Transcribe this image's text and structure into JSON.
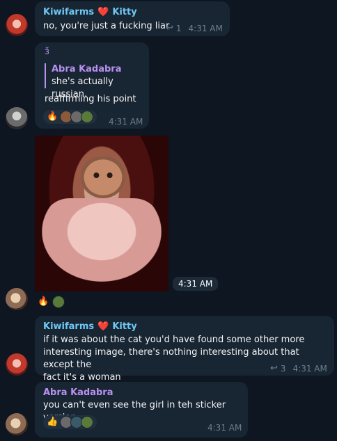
{
  "messages": [
    {
      "sender_part1": "Kiwifarms",
      "heart": "❤️",
      "sender_part2": "Kitty",
      "text": "no, you're just a fucking liar",
      "replies": "1",
      "time": "4:31 AM"
    },
    {
      "sticker_glyph": "ɜ̆",
      "quote_name": "Abra Kadabra",
      "quote_text": "she's actually russian.",
      "text": "reaffirming his point",
      "reaction_emoji": "🔥",
      "time": "4:31 AM"
    },
    {
      "time": "4:31 AM",
      "reaction_emoji": "🔥"
    },
    {
      "sender_part1": "Kiwifarms",
      "heart": "❤️",
      "sender_part2": "Kitty",
      "text_lines": [
        "if it was about the cat you'd have found some other more",
        "interesting image, there's nothing interesting about that except the",
        "fact it's a woman"
      ],
      "replies": "3",
      "time": "4:31 AM"
    },
    {
      "sender": "Abra Kadabra",
      "text": "you can't even see the girl in teh sticker version",
      "reaction_emoji": "👍",
      "time": "4:31 AM"
    }
  ],
  "icons": {
    "reply": "reply-arrow-icon"
  },
  "colors": {
    "background": "#0e1621",
    "bubble": "#182533",
    "name_blue": "#6ec8f5",
    "name_purple": "#b991f0",
    "meta": "#6d7f8f"
  }
}
